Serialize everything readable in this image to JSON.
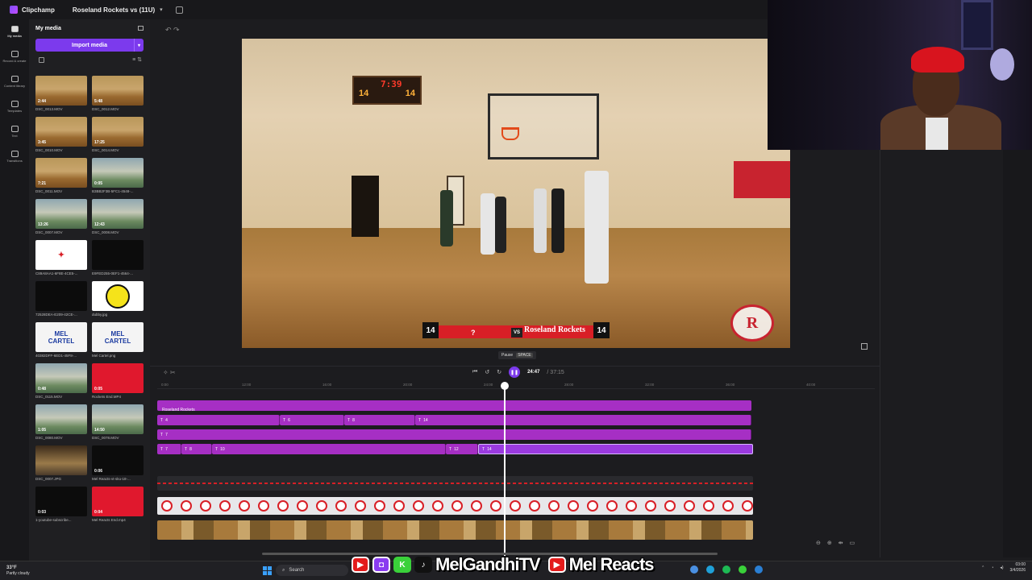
{
  "titlebar": {
    "app": "Clipchamp",
    "project": "Roseland Rockets vs (11U)"
  },
  "rail": [
    {
      "label": "My media",
      "icon": "folder-icon"
    },
    {
      "label": "Record & create",
      "icon": "record-icon"
    },
    {
      "label": "Content library",
      "icon": "library-icon"
    },
    {
      "label": "Templates",
      "icon": "templates-icon"
    },
    {
      "label": "Text",
      "icon": "text-icon"
    },
    {
      "label": "Transitions",
      "icon": "transitions-icon"
    }
  ],
  "media": {
    "title": "My media",
    "import_label": "Import media",
    "items": [
      {
        "name": "DSC_0013.MOV",
        "duration": "2:44",
        "thumb": "gym"
      },
      {
        "name": "DSC_0012.MOV",
        "duration": "5:48",
        "thumb": "gym"
      },
      {
        "name": "DSC_0010.MOV",
        "duration": "3:45",
        "thumb": "gym"
      },
      {
        "name": "DSC_0014.MOV",
        "duration": "17:25",
        "thumb": "gym"
      },
      {
        "name": "DSC_0011.MOV",
        "duration": "7:21",
        "thumb": "gym"
      },
      {
        "name": "B3BB2F3B-5FC1-4548-...",
        "duration": "0:05",
        "thumb": "gymg"
      },
      {
        "name": "DSC_0007.MOV",
        "duration": "13:26",
        "thumb": "gymg"
      },
      {
        "name": "DSC_0008.MOV",
        "duration": "12:43",
        "thumb": "gymg"
      },
      {
        "name": "C89A8AA1-6F8E-4CE5-...",
        "duration": "",
        "thumb": "red"
      },
      {
        "name": "E9FED255-0EF1-4564-...",
        "duration": "",
        "thumb": "black"
      },
      {
        "name": "72528DEA-E209-42CE-...",
        "duration": "",
        "thumb": "black"
      },
      {
        "name": "dubby.jpg",
        "duration": "",
        "thumb": "smile"
      },
      {
        "name": "40382DFF-6ED1-45F8-...",
        "duration": "",
        "thumb": "blue"
      },
      {
        "name": "Mel Cartel.png",
        "duration": "",
        "thumb": "blue"
      },
      {
        "name": "DSC_0115.MOV",
        "duration": "0:48",
        "thumb": "gymg"
      },
      {
        "name": "Rockets End.MP4",
        "duration": "0:05",
        "thumb": "redb"
      },
      {
        "name": "DSC_0080.MOV",
        "duration": "1:05",
        "thumb": "gymg"
      },
      {
        "name": "DSC_0078.MOV",
        "duration": "14:50",
        "thumb": "gymg"
      },
      {
        "name": "DSC_0007.JPG",
        "duration": "",
        "thumb": "room"
      },
      {
        "name": "Mel Reacts-vt-sku-18-...",
        "duration": "0:06",
        "thumb": "black"
      },
      {
        "name": "1-youtube-subscribe...",
        "duration": "0:03",
        "thumb": "black"
      },
      {
        "name": "Mel Reacts End.mp4",
        "duration": "0:04",
        "thumb": "redb"
      }
    ]
  },
  "stickers": {
    "mel_cartel": "MEL CARTEL",
    "smile": "☺"
  },
  "video": {
    "scoreboard_clock": "7:39",
    "scoreboard_left": "14",
    "scoreboard_right": "14",
    "overlay_left_score": "14",
    "overlay_unknown": "?",
    "overlay_vs": "VS",
    "overlay_team": "Roseland Rockets",
    "overlay_right_score": "14",
    "logo_letter": "R"
  },
  "tooltip": {
    "label": "Pause",
    "key": "SPACE"
  },
  "playback": {
    "current": "24:47",
    "total": "/ 37:15"
  },
  "ruler": [
    "0:00",
    "12:00",
    "16:00",
    "20:00",
    "24:00",
    "28:00",
    "32:00",
    "36:00",
    "40:00"
  ],
  "tracks": {
    "title_clip": "Roseland Rockets",
    "row2": [
      {
        "label": "T",
        "num": "4"
      },
      {
        "label": "T",
        "num": "6"
      },
      {
        "label": "T",
        "num": "8"
      },
      {
        "label": "T",
        "num": "14"
      }
    ],
    "row3": [
      {
        "label": "T",
        "num": "7"
      }
    ],
    "row4": [
      {
        "label": "T",
        "num": "7"
      },
      {
        "label": "T",
        "num": "8"
      },
      {
        "label": "T",
        "num": "10"
      },
      {
        "label": "T",
        "num": "12"
      },
      {
        "label": "T",
        "num": "14"
      }
    ]
  },
  "taskbar": {
    "temp": "33°F",
    "weather": "Partly cloudy",
    "search": "Search",
    "channel_name": "MelGandhiTV",
    "channel_name_2": "Mel Reacts",
    "time": "03:00",
    "date": "3/4/2026"
  }
}
